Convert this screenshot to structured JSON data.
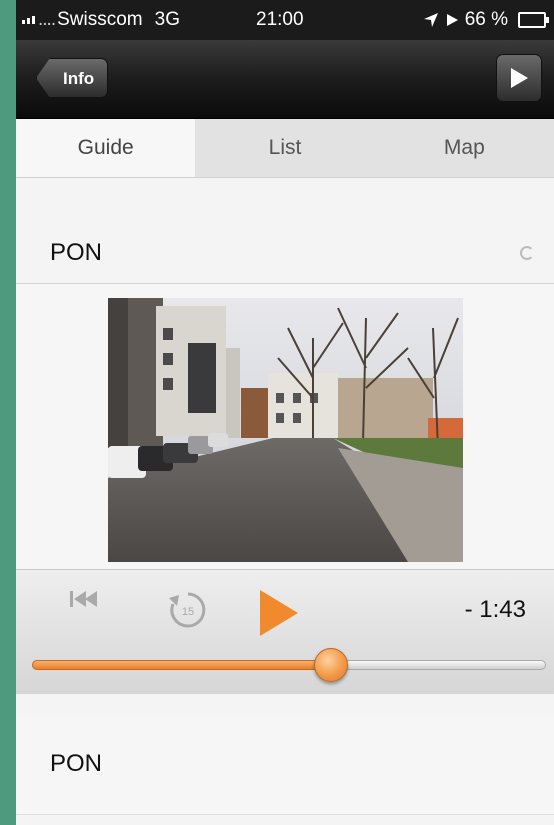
{
  "status": {
    "carrier_dots": "....",
    "carrier": "Swisscom",
    "network": "3G",
    "time": "21:00",
    "battery": "66 %",
    "battery_level": 0.66
  },
  "navbar": {
    "back_label": "Info",
    "play_icon": "play-icon"
  },
  "tabs": [
    {
      "label": "Guide",
      "active": true
    },
    {
      "label": "List",
      "active": false
    },
    {
      "label": "Map",
      "active": false
    }
  ],
  "guide": {
    "title": "PON",
    "time_remaining": "- 1:43",
    "progress": 0.58,
    "description": "PON"
  },
  "colors": {
    "accent": "#f08a2c",
    "background_outer": "#4e9a7e"
  }
}
